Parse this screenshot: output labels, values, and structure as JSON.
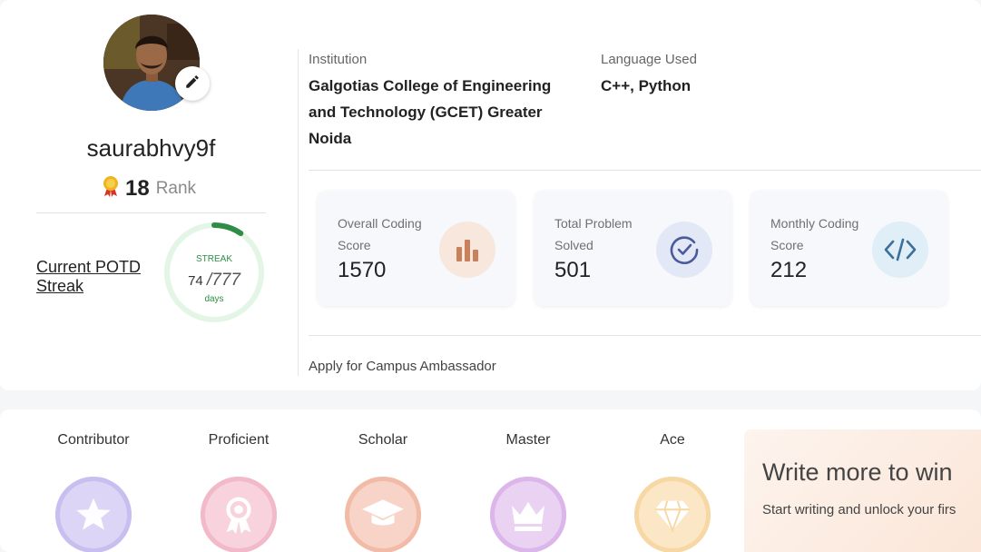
{
  "profile": {
    "username": "saurabhvy9f",
    "rank_value": "18",
    "rank_label": "Rank",
    "potd_label": "Current POTD Streak",
    "streak_title": "STREAK",
    "streak_current": "74",
    "streak_total": "/777",
    "streak_unit": "days",
    "streak_fraction": 0.095
  },
  "info": {
    "institution_label": "Institution",
    "institution_value": "Galgotias College of Engineering and Technology (GCET) Greater Noida",
    "language_label": "Language Used",
    "language_value": "C++, Python"
  },
  "stats": [
    {
      "label": "Overall Coding Score",
      "value": "1570",
      "icon": "bar-chart-icon",
      "icon_bg": "#f7e7dc",
      "icon_color": "#c8815a"
    },
    {
      "label": "Total Problem Solved",
      "value": "501",
      "icon": "check-circle-icon",
      "icon_bg": "#e3e8f6",
      "icon_color": "#4a5a9a"
    },
    {
      "label": "Monthly Coding Score",
      "value": "212",
      "icon": "code-icon",
      "icon_bg": "#dfeef7",
      "icon_color": "#3c6f9a"
    }
  ],
  "ambassador_link": "Apply for Campus Ambassador",
  "badges": [
    {
      "label": "Contributor",
      "icon": "star-icon",
      "bg": "#dcd5f5",
      "ring": "#c9bef0",
      "fg": "#a898e2"
    },
    {
      "label": "Proficient",
      "icon": "ribbon-award-icon",
      "bg": "#f8d2dc",
      "ring": "#f2b9c8",
      "fg": "#e89aad"
    },
    {
      "label": "Scholar",
      "icon": "graduation-cap-icon",
      "bg": "#f8d4c8",
      "ring": "#f2bba8",
      "fg": "#eca58c"
    },
    {
      "label": "Master",
      "icon": "crown-icon",
      "bg": "#ead2f2",
      "ring": "#dcb6ea",
      "fg": "#cc98de"
    },
    {
      "label": "Ace",
      "icon": "diamond-icon",
      "bg": "#fbe7c6",
      "ring": "#f7d8a4",
      "fg": "#f2c67a"
    }
  ],
  "promo": {
    "title": "Write more to win",
    "subtitle": "Start writing and unlock your firs"
  }
}
